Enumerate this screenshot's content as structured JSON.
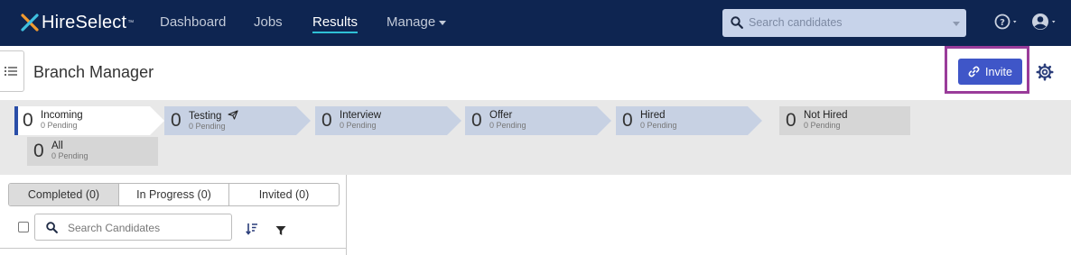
{
  "brand": {
    "name": "HireSelect",
    "tm": "™"
  },
  "nav": {
    "links": [
      {
        "label": "Dashboard"
      },
      {
        "label": "Jobs"
      },
      {
        "label": "Results"
      },
      {
        "label": "Manage"
      }
    ],
    "active": "Results",
    "search_placeholder": "Search candidates"
  },
  "page": {
    "title": "Branch Manager"
  },
  "actions": {
    "invite_label": "Invite"
  },
  "stages": [
    {
      "count": "0",
      "name": "Incoming",
      "pending": "0 Pending"
    },
    {
      "count": "0",
      "name": "Testing",
      "pending": "0 Pending"
    },
    {
      "count": "0",
      "name": "Interview",
      "pending": "0 Pending"
    },
    {
      "count": "0",
      "name": "Offer",
      "pending": "0 Pending"
    },
    {
      "count": "0",
      "name": "Hired",
      "pending": "0 Pending"
    },
    {
      "count": "0",
      "name": "Not Hired",
      "pending": "0 Pending"
    },
    {
      "count": "0",
      "name": "All",
      "pending": "0 Pending"
    }
  ],
  "tabs": [
    {
      "label": "Completed (0)"
    },
    {
      "label": "In Progress (0)"
    },
    {
      "label": "Invited (0)"
    }
  ],
  "candidate_search": {
    "placeholder": "Search Candidates"
  },
  "icons": {
    "logo": "hireselect-x-logo-icon",
    "search": "search-icon",
    "help": "help-icon",
    "user": "user-avatar-icon",
    "sidebar": "list-icon",
    "invite": "link-icon",
    "settings": "gear-icon",
    "testing": "paper-plane-icon",
    "sort": "sort-icon",
    "filter": "filter-icon"
  },
  "colors": {
    "nav_bg": "#0e2551",
    "accent": "#3f56c8",
    "active_underline": "#2fc1d6",
    "highlight": "#9a3c9a",
    "stage_arrow": "#c7d1e3"
  }
}
